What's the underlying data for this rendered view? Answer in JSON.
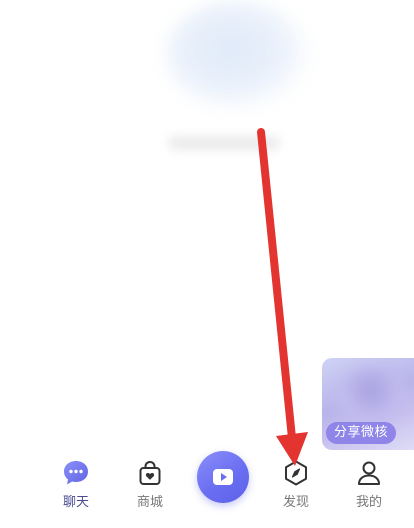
{
  "tabs": [
    {
      "label": "聊天",
      "icon": "chat-bubble-icon",
      "active": true
    },
    {
      "label": "商城",
      "icon": "shopping-bag-icon",
      "active": false
    },
    {
      "label": "",
      "icon": "play-icon",
      "active": false
    },
    {
      "label": "发现",
      "icon": "compass-icon",
      "active": false
    },
    {
      "label": "我的",
      "icon": "profile-icon",
      "active": false
    }
  ],
  "share_card": {
    "label": "分享微核"
  },
  "colors": {
    "accent": "#6a6ef2",
    "active_tab_text": "#4a4a90",
    "inactive_tab_text": "#777777",
    "annotation_arrow": "#e3342f",
    "share_label_bg": "#8f84e8"
  }
}
